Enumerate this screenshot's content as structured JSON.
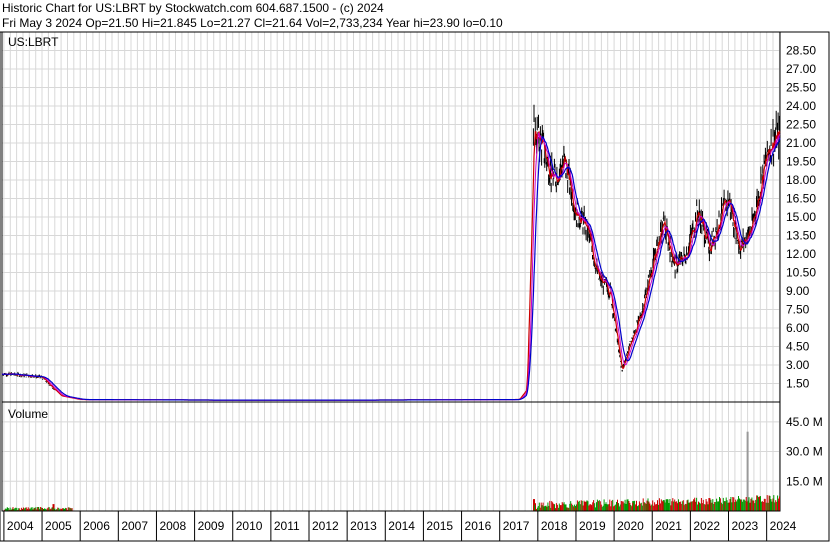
{
  "header": {
    "line1": "Historic Chart for US:LBRT by Stockwatch.com 604.687.1500 - (c) 2024",
    "line2": "Fri May  3 2024   Op=21.50   Hi=21.845   Lo=21.27   Cl=21.64   Vol=2,733,234   Year hi=23.90   lo=0.10"
  },
  "chart_data": [
    {
      "type": "line",
      "panel": "price",
      "title": "US:LBRT",
      "ylim": [
        0,
        30
      ],
      "y_ticks": [
        "1.50",
        "3.00",
        "4.50",
        "6.00",
        "7.50",
        "9.00",
        "10.50",
        "12.00",
        "13.50",
        "15.00",
        "16.50",
        "18.00",
        "19.50",
        "21.00",
        "22.50",
        "24.00",
        "25.50",
        "27.00",
        "28.50"
      ],
      "grid": true,
      "colors": {
        "price": "#000000",
        "ma_fast": "#cc0000",
        "ma_slow": "#0000cc",
        "ma_mid": "#cc00cc"
      },
      "x": [
        2004.0,
        2004.4,
        2004.8,
        2005.0,
        2005.5,
        2006.0,
        2010.0,
        2013.0,
        2017.5,
        2017.7,
        2017.9,
        2018.1,
        2018.4,
        2018.7,
        2019.0,
        2019.3,
        2019.6,
        2019.9,
        2020.2,
        2020.4,
        2020.7,
        2021.0,
        2021.3,
        2021.6,
        2021.9,
        2022.2,
        2022.5,
        2022.8,
        2023.0,
        2023.3,
        2023.6,
        2023.9,
        2024.1,
        2024.34
      ],
      "close": [
        2.3,
        2.2,
        2.1,
        2.0,
        0.5,
        0.2,
        0.15,
        0.15,
        0.2,
        1.0,
        22.0,
        21.0,
        18.0,
        19.5,
        15.5,
        14.0,
        10.0,
        9.0,
        2.5,
        4.5,
        7.0,
        11.0,
        14.5,
        11.0,
        12.0,
        15.5,
        12.5,
        15.0,
        16.5,
        12.5,
        14.0,
        18.5,
        21.0,
        21.64
      ],
      "annotations": [
        "US:LBRT"
      ]
    },
    {
      "type": "bar",
      "panel": "volume",
      "title": "Volume",
      "ylim": [
        0,
        55
      ],
      "y_ticks": [
        "15.0 M",
        "30.0 M",
        "45.0 M"
      ],
      "colors": {
        "up": "#009900",
        "down": "#cc0000",
        "spike": "#999999"
      },
      "x": [
        2004.1,
        2004.5,
        2004.9,
        2005.3,
        2005.6,
        2017.9,
        2018.2,
        2018.6,
        2019.0,
        2019.4,
        2019.8,
        2020.1,
        2020.5,
        2020.9,
        2021.3,
        2021.7,
        2022.1,
        2022.5,
        2022.9,
        2023.2,
        2023.5,
        2023.8,
        2024.1,
        2024.3
      ],
      "values": [
        1.5,
        1.0,
        2.0,
        3.5,
        1.0,
        6.0,
        2.5,
        3.0,
        2.5,
        3.0,
        3.5,
        4.0,
        5.0,
        4.5,
        5.5,
        4.5,
        5.5,
        6.5,
        5.0,
        4.5,
        40.0,
        7.0,
        6.0,
        5.0
      ]
    }
  ],
  "x_axis": {
    "years": [
      "2004",
      "2005",
      "2006",
      "2007",
      "2008",
      "2009",
      "2010",
      "2011",
      "2012",
      "2013",
      "2014",
      "2015",
      "2016",
      "2017",
      "2018",
      "2019",
      "2020",
      "2021",
      "2022",
      "2023",
      "2024"
    ],
    "year_starts": [
      2004,
      2005,
      2006,
      2007,
      2008,
      2009,
      2010,
      2011,
      2012,
      2013,
      2014,
      2015,
      2016,
      2017,
      2018,
      2019,
      2020,
      2021,
      2022,
      2023,
      2024
    ],
    "range": [
      2003.95,
      2024.35
    ]
  }
}
